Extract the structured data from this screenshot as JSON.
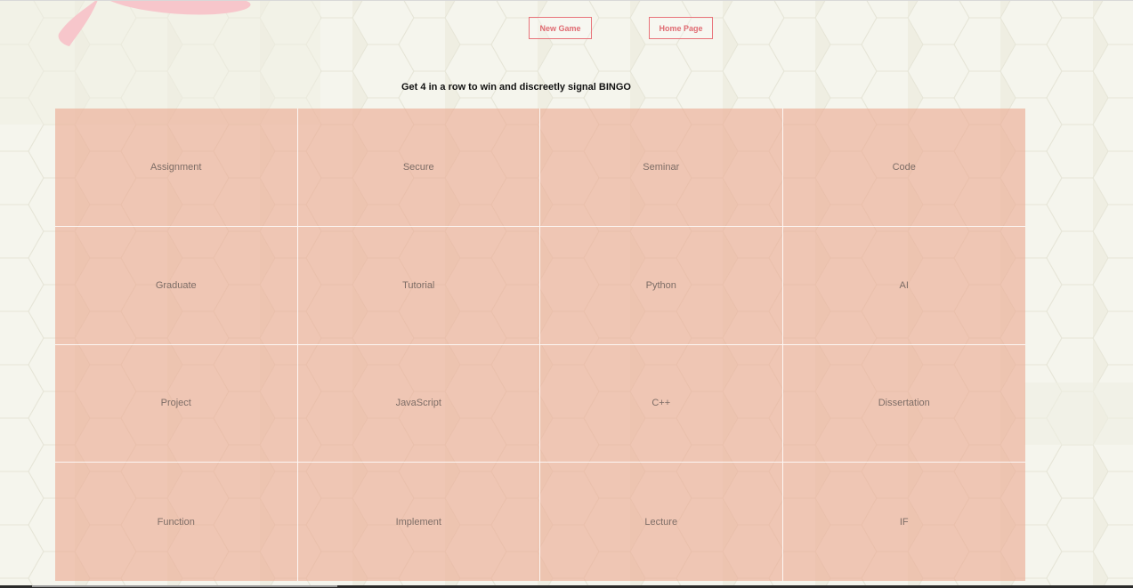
{
  "buttons": {
    "new_game": "New Game",
    "home_page": "Home Page"
  },
  "instructions": "Get 4 in a row to win and discreetly signal BINGO",
  "board": {
    "cells": [
      "Assignment",
      "Secure",
      "Seminar",
      "Code",
      "Graduate",
      "Tutorial",
      "Python",
      "AI",
      "Project",
      "JavaScript",
      "C++",
      "Dissertation",
      "Function",
      "Implement",
      "Lecture",
      "IF"
    ]
  },
  "colors": {
    "background": "#efeee2",
    "hexagon": "#f6f6ef",
    "button_border": "#e8737a",
    "cell_fill": "#ebaa91",
    "cell_text": "#7d6d66",
    "decor_pink": "#f7c6cb"
  }
}
